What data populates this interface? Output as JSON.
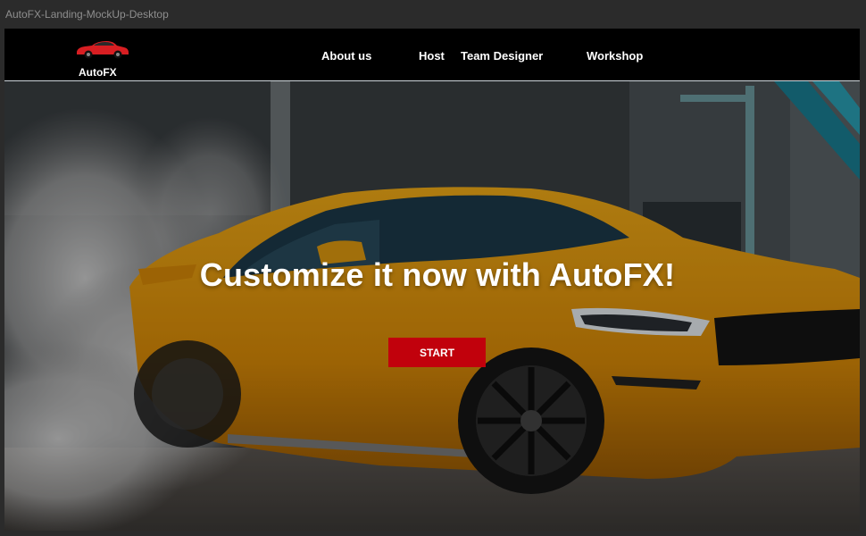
{
  "frame": {
    "title": "AutoFX-Landing-MockUp-Desktop"
  },
  "navbar": {
    "brand": "AutoFX",
    "items": [
      {
        "label": "About us"
      },
      {
        "label": "Host"
      },
      {
        "label": "Team Designer"
      },
      {
        "label": "Workshop"
      }
    ]
  },
  "hero": {
    "title": "Customize it now with AutoFX!",
    "cta_label": "START",
    "background_image": "yellow-sports-car-burnout-photo"
  },
  "colors": {
    "accent": "#c1010c",
    "car": "#e59a0f",
    "nav_bg": "#000000",
    "frame_bg": "#2b2b2b"
  }
}
